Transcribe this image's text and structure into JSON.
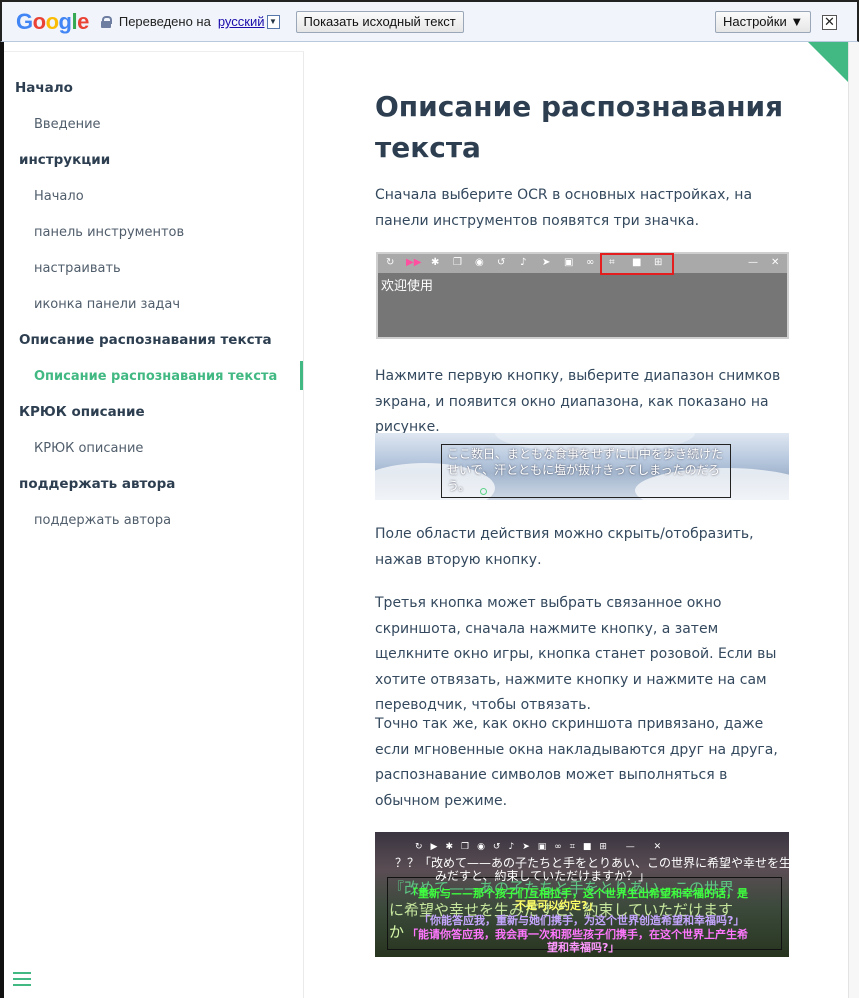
{
  "translate_bar": {
    "logo": [
      "G",
      "o",
      "o",
      "g",
      "l",
      "e"
    ],
    "translated_to": "Переведено на",
    "language": "русский",
    "show_original": "Показать исходный текст",
    "settings": "Настройки ▼",
    "close": "✕"
  },
  "sidebar": {
    "sections": [
      {
        "title": "Начало",
        "items": [
          "Введение"
        ]
      },
      {
        "title": "инструкции",
        "items": [
          "Начало",
          "панель инструментов",
          "настраивать",
          "иконка панели задач"
        ]
      },
      {
        "title": "Описание распознавания текста",
        "items": [
          "Описание распознавания текста"
        ]
      },
      {
        "title": "КРЮК описание",
        "items": [
          "КРЮК описание"
        ]
      },
      {
        "title": "поддержать автора",
        "items": [
          "поддержать автора"
        ]
      }
    ],
    "active_item": "Описание распознавания текста"
  },
  "main": {
    "title": "Описание распознавания текста",
    "p1": "Сначала выберите OCR в основных настройках, на панели инструментов появятся три значка.",
    "img1_text": "欢迎使用",
    "p2": "Нажмите первую кнопку, выберите диапазон снимков экрана, и появится окно диапазона, как показано на рисунке.",
    "img2_text": "ここ数日、まともな食事をせずに山中を歩き続けたせいで、汗とともに塩が抜けきってしまったのだろう。",
    "p3": "Поле области действия можно скрыть/отобразить, нажав вторую кнопку.",
    "p4": "Третья кнопка может выбрать связанное окно скриншота, сначала нажмите кнопку, а затем щелкните окно игры, кнопка станет розовой. Если вы хотите отвязать, нажмите кнопку и нажмите на сам переводчик, чтобы отвязать.",
    "p5": "Точно так же, как окно скриншота привязано, даже если мгновенные окна накладываются друг на друга, распознавание символов может выполняться в обычном режиме.",
    "img3_lines": {
      "jp1": "？？「改めて——あの子たちと手をとりあい、この世界に希望や幸せを生",
      "jp2": "みだすと、約束していただけますか？」",
      "big1": "『改めて——あの子たちと手をとりあい、この世界",
      "big2": "に希望や幸せを生みだすと、約束していただけます",
      "big3": "か",
      "cn1": "「重新与——那个孩子们互相拉手，这个世界生出希望和幸福的话，是",
      "cn2": "不是可以约定?」",
      "cn3": "「你能答应我，重新与她们携手，为这个世界创造希望和幸福吗?」",
      "cn4": "「能请你答应我，我会再一次和那些孩子们携手，在这个世界上产生希",
      "cn5": "望和幸福吗?」"
    }
  }
}
